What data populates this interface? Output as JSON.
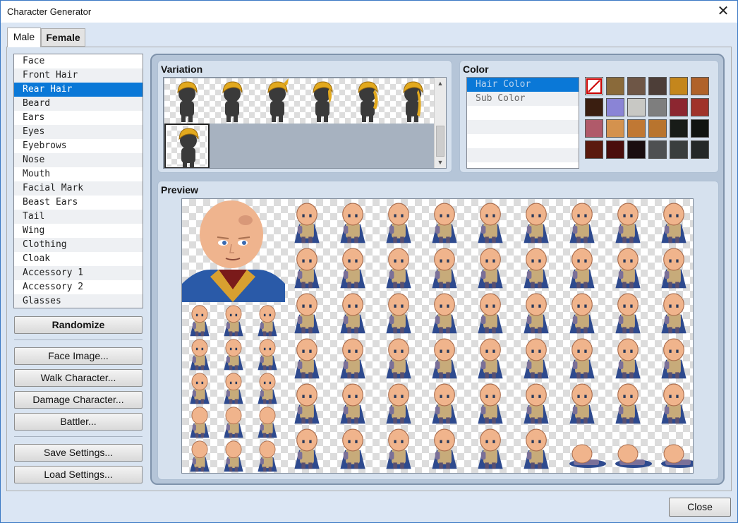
{
  "window": {
    "title": "Character Generator",
    "close_glyph": "✕"
  },
  "tabs": [
    {
      "label": "Male"
    },
    {
      "label": "Female"
    }
  ],
  "parts": [
    "Face",
    "Front Hair",
    "Rear Hair",
    "Beard",
    "Ears",
    "Eyes",
    "Eyebrows",
    "Nose",
    "Mouth",
    "Facial Mark",
    "Beast Ears",
    "Tail",
    "Wing",
    "Clothing",
    "Cloak",
    "Accessory 1",
    "Accessory 2",
    "Glasses"
  ],
  "parts_selected": "Rear Hair",
  "buttons": {
    "randomize": "Randomize",
    "face_image": "Face Image...",
    "walk_character": "Walk Character...",
    "damage_character": "Damage Character...",
    "battler": "Battler...",
    "save_settings": "Save Settings...",
    "load_settings": "Load Settings...",
    "close": "Close"
  },
  "variation": {
    "title": "Variation",
    "selected_index": 6,
    "count": 7,
    "scroll_up": "▲",
    "scroll_down": "▼"
  },
  "color": {
    "title": "Color",
    "options": [
      "Hair Color",
      "Sub Color"
    ],
    "selected": "Hair Color",
    "swatches": [
      "none",
      "#8a6a3a",
      "#6e5646",
      "#4d3e38",
      "#c4861c",
      "#b0622a",
      "#3a1e10",
      "#8a84d6",
      "#c8c8c4",
      "#7e7e7e",
      "#8c2630",
      "#a0332a",
      "#b05a6a",
      "#d4924e",
      "#c07834",
      "#b8742e",
      "#181c18",
      "#101410",
      "#5a1a0e",
      "#4a0e0c",
      "#1a0e10",
      "#4e5052",
      "#3a3e3e",
      "#242828"
    ]
  },
  "preview": {
    "title": "Preview"
  },
  "colors": {
    "accent": "#0a78d7",
    "frame": "#7f93ab",
    "panel": "#d6e1ee",
    "window_bg": "#dbe6f4"
  }
}
